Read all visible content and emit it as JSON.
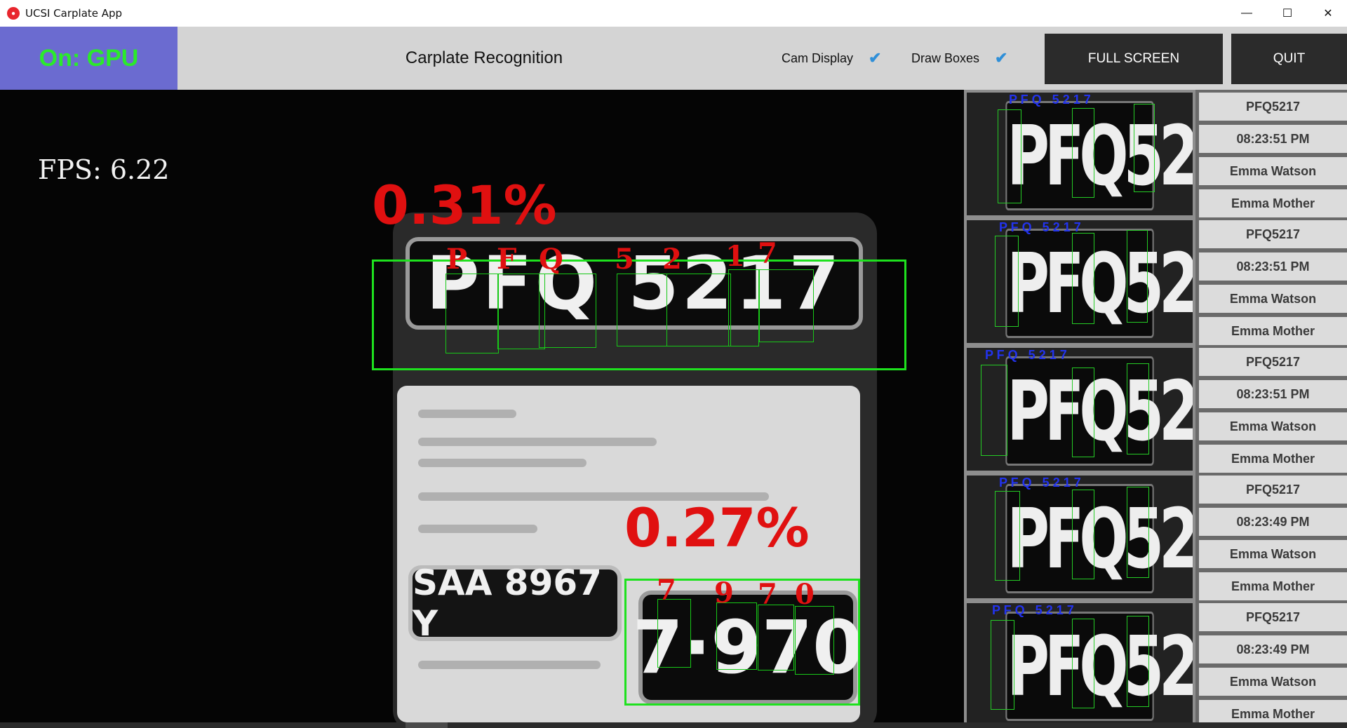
{
  "window": {
    "title": "UCSI Carplate App",
    "icon": "app-logo-icon",
    "controls": {
      "minimize": "—",
      "maximize": "☐",
      "close": "✕"
    }
  },
  "toolbar": {
    "status": "On: GPU",
    "heading": "Carplate Recognition",
    "cam_display_label": "Cam Display",
    "draw_boxes_label": "Draw Boxes",
    "check_glyph": "✔",
    "full_screen_label": "FULL SCREEN",
    "quit_label": "QUIT",
    "colors": {
      "status_bg": "#6b6bd0",
      "status_text": "#2bea2b",
      "check": "#2f8fd8",
      "button_bg": "#2b2b2b"
    }
  },
  "camera": {
    "fps_text": "FPS: 6.22",
    "detections": [
      {
        "confidence": "0.31%",
        "plate_text": "PFQ 5217",
        "chars": [
          "P",
          "F",
          "Q",
          "5",
          "2",
          "1",
          "7"
        ]
      },
      {
        "confidence": "0.27%",
        "plate_text": "7·970",
        "chars": [
          "7",
          "9",
          "7",
          "0"
        ]
      }
    ],
    "background_plate": "SAA 8967 Y",
    "colors": {
      "box": "#1ee11e",
      "label": "#e01010"
    }
  },
  "history": [
    {
      "plate_text": "PFQ5217",
      "plate": "PFQ5217",
      "time": "08:23:51 PM",
      "name1": "Emma Watson",
      "name2": "Emma Mother"
    },
    {
      "plate_text": "PFQ5217",
      "plate": "PFQ5217",
      "time": "08:23:51 PM",
      "name1": "Emma Watson",
      "name2": "Emma Mother"
    },
    {
      "plate_text": "PFQ5217",
      "plate": "PFQ5217",
      "time": "08:23:51 PM",
      "name1": "Emma Watson",
      "name2": "Emma Mother"
    },
    {
      "plate_text": "PFQ5217",
      "plate": "PFQ5217",
      "time": "08:23:49 PM",
      "name1": "Emma Watson",
      "name2": "Emma Mother"
    },
    {
      "plate_text": "PFQ5217",
      "plate": "PFQ5217",
      "time": "08:23:49 PM",
      "name1": "Emma Watson",
      "name2": "Emma Mother"
    }
  ]
}
